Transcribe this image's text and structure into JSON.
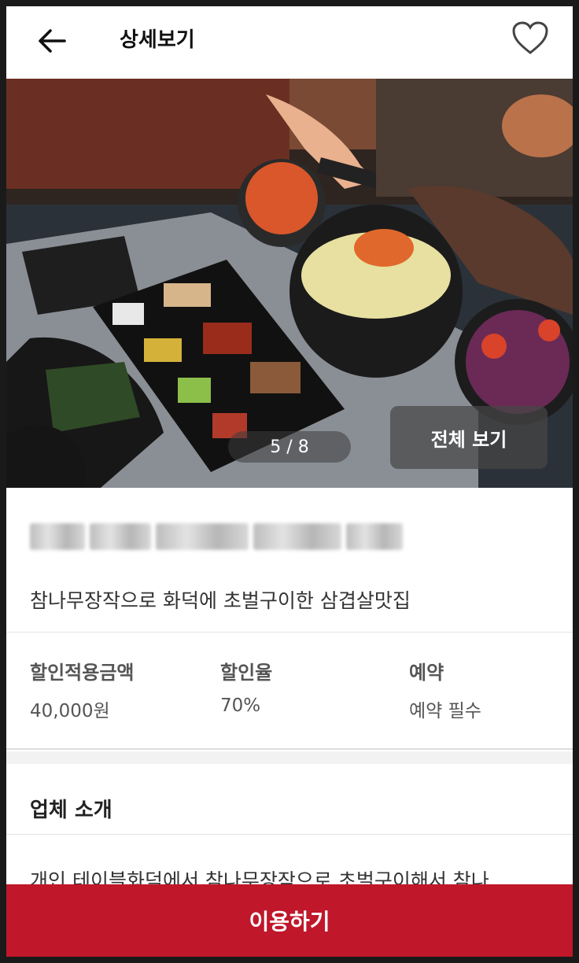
{
  "header": {
    "title": "상세보기",
    "back_icon": "arrow-left-icon",
    "favorite_icon": "heart-outline-icon"
  },
  "gallery": {
    "counter": "5 / 8",
    "view_all_label": "전체 보기"
  },
  "store": {
    "tagline": "참나무장작으로 화덕에 초벌구이한 삼겹살맛집"
  },
  "stats": [
    {
      "label": "할인적용금액",
      "value": "40,000원"
    },
    {
      "label": "할인율",
      "value": "70%"
    },
    {
      "label": "예약",
      "value": "예약 필수"
    }
  ],
  "intro": {
    "title": "업체 소개",
    "text": "개인 테이블화덕에서 참나무장작으로 초벌구이해서 참나"
  },
  "cta": {
    "label": "이용하기",
    "color": "#c0172a"
  }
}
